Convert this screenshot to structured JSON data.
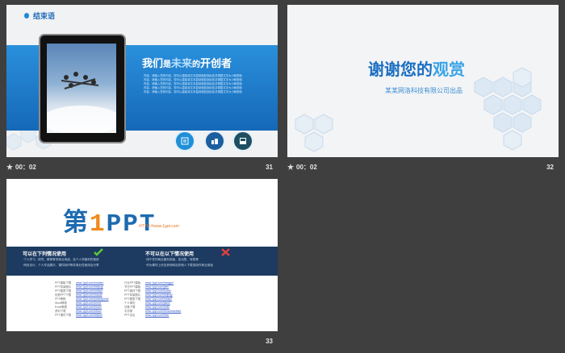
{
  "slides": [
    {
      "number": "31",
      "time": "00：02",
      "title": "结束语",
      "heading_parts": [
        "我们",
        "是",
        "未来",
        "的",
        "开创者"
      ],
      "body_lines": [
        "内容，请输入您的内容，您可以直接将文本复制粘贴到此处并调整文字大小和颜色",
        "内容，请输入您的内容，您可以直接将文本复制粘贴到此处并调整文字大小和颜色",
        "内容，请输入您的内容，您可以直接将文本复制粘贴到此处并调整文字大小和颜色",
        "内容，请输入您的内容，您可以直接将文本复制粘贴到此处并调整文字大小和颜色",
        "内容，请输入您的内容，您可以直接将文本复制粘贴到此处并调整文字大小和颜色"
      ],
      "icons": [
        "document-icon",
        "building-icon",
        "newspaper-icon"
      ]
    },
    {
      "number": "32",
      "time": "00：02",
      "heading_parts": [
        "谢谢您的",
        "观赏"
      ],
      "subtitle": "某某网洛科技有限公司出品"
    },
    {
      "number": "33",
      "logo_parts": [
        "第",
        "1",
        "PPT"
      ],
      "logo_url": "HTTP://www.1ppt.com",
      "allowed_title": "可以在下列情况使用",
      "allowed_lines": [
        "·个人学习、研究、教育等非商业用途，及个人非营利的使用",
        "·网页设计、个人作品展示、课件制作等非商业性使用及分享"
      ],
      "forbidden_title": "不可以在以下情况使用",
      "forbidden_lines": [
        "·用于任何商业盈利用途，如出售、转售等",
        "·作为素材上传至其他网站供他人下载或用作商业用途"
      ],
      "links_left": [
        [
          "PPT模板下载",
          "www.1ppt.com/moban/"
        ],
        [
          "PPT背景图片",
          "www.1ppt.com/beijing/"
        ],
        [
          "PPT图表下载",
          "www.1ppt.com/tubiao/"
        ],
        [
          "优秀PPT下载",
          "www.1ppt.com/xiazai/"
        ],
        [
          "PPT教程",
          "www.1ppt.com/powerpoint/"
        ],
        [
          "Word教程",
          "www.1ppt.com/word/"
        ],
        [
          "Excel教程",
          "www.1ppt.com/excel/"
        ],
        [
          "资料下载",
          "www.1ppt.com/ziliao/"
        ],
        [
          "PPT课件下载",
          "www.1ppt.com/kejian/"
        ]
      ],
      "links_right": [
        [
          "行业PPT模板",
          "www.1ppt.com/hangye/"
        ],
        [
          "节日PPT模板",
          "www.1ppt.com/jieri/"
        ],
        [
          "PPT素材下载",
          "www.1ppt.com/sucai/"
        ],
        [
          "PPT背景图片",
          "www.1ppt.com/beijing/"
        ],
        [
          "PPT图表下载",
          "www.1ppt.com/tubiao/"
        ],
        [
          "个人简历",
          "www.1ppt.com/jianli/"
        ],
        [
          "试卷下载",
          "www.1ppt.com/shiti/"
        ],
        [
          "手抄报",
          "www.1ppt.com/shouchaobao/"
        ],
        [
          "PPT论坛",
          "www.1ppt.com/bbs/"
        ]
      ]
    }
  ],
  "colors": {
    "background": "#3f3f3f",
    "accent_blue": "#1e6bb8",
    "dark_band": "#1d3a60",
    "orange": "#f08a1e"
  }
}
